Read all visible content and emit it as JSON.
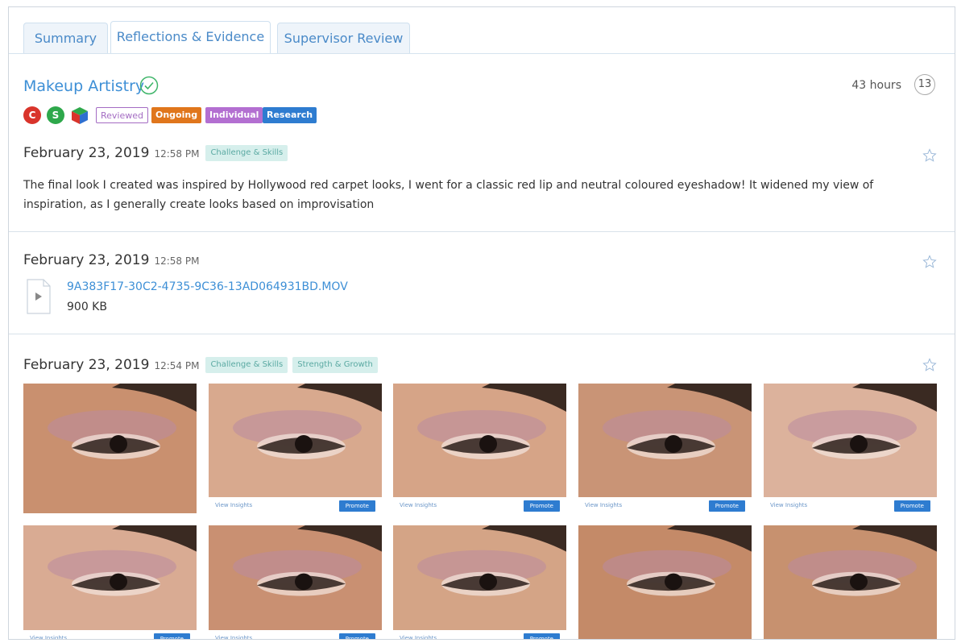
{
  "tabs": [
    {
      "label": "Summary",
      "active": false
    },
    {
      "label": "Reflections & Evidence",
      "active": true
    },
    {
      "label": "Supervisor Review",
      "active": false
    }
  ],
  "header": {
    "title": "Makeup Artistry",
    "hours": "43 hours",
    "count": "13",
    "circles": [
      {
        "letter": "C",
        "color": "#d9342b"
      },
      {
        "letter": "S",
        "color": "#2ea84b"
      }
    ],
    "tags": [
      {
        "label": "Reviewed"
      },
      {
        "label": "Ongoing"
      },
      {
        "label": "Individual"
      },
      {
        "label": "Research"
      }
    ]
  },
  "entries": [
    {
      "date": "February 23, 2019",
      "time": "12:58 PM",
      "skills": [
        "Challenge & Skills"
      ],
      "text": "The final look I created was inspired by Hollywood red carpet looks, I went for a classic red lip and neutral coloured eyeshadow! It widened my view of inspiration, as I generally create looks based on improvisation"
    },
    {
      "date": "February 23, 2019",
      "time": "12:58 PM",
      "file_name": "9A383F17-30C2-4735-9C36-13AD064931BD.MOV",
      "file_size": "900 KB"
    },
    {
      "date": "February 23, 2019",
      "time": "12:54 PM",
      "skills": [
        "Challenge & Skills",
        "Strength & Growth"
      ]
    }
  ],
  "gallery": {
    "view_insights": "View Insights",
    "promote": "Promote",
    "photos": [
      {
        "tone": "#c9906f",
        "has_bar": false
      },
      {
        "tone": "#d8a98e",
        "has_bar": true
      },
      {
        "tone": "#d6a487",
        "has_bar": true
      },
      {
        "tone": "#c99476",
        "has_bar": true
      },
      {
        "tone": "#dcb29c",
        "has_bar": true
      },
      {
        "tone": "#d9ab93",
        "has_bar": true
      },
      {
        "tone": "#c99072",
        "has_bar": true
      },
      {
        "tone": "#d4a486",
        "has_bar": true
      },
      {
        "tone": "#c48a68",
        "has_bar": false
      },
      {
        "tone": "#c7916f",
        "has_bar": false
      }
    ]
  }
}
